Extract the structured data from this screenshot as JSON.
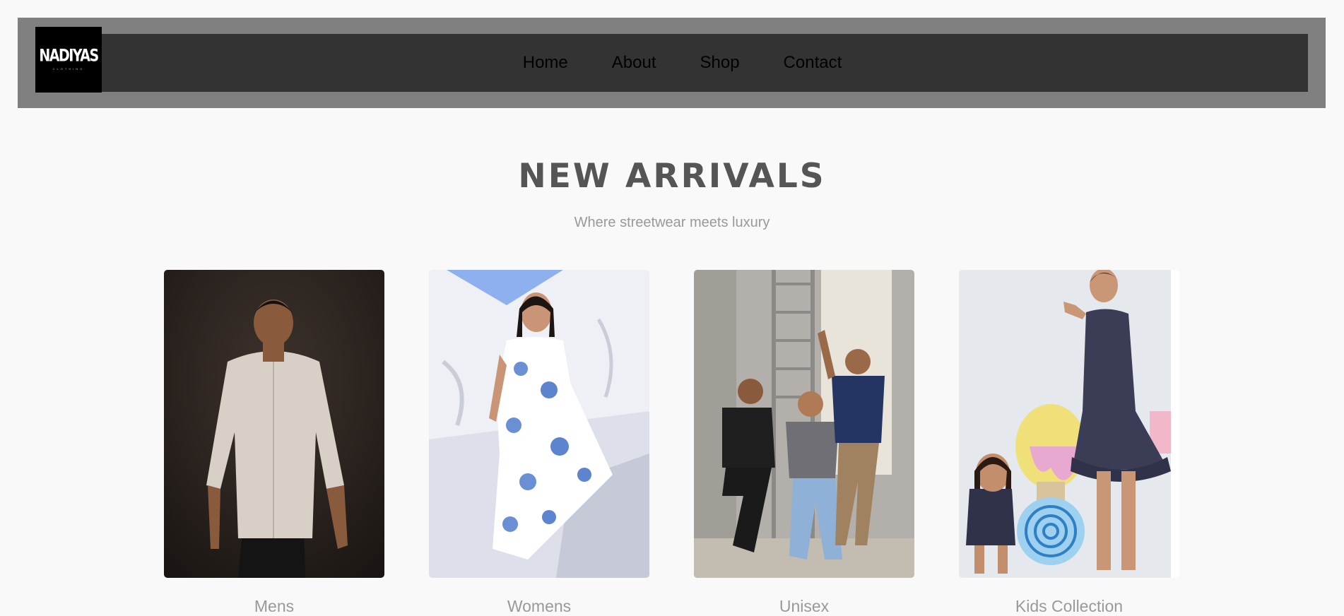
{
  "header": {
    "logo": {
      "text": "NADIYAS",
      "subtext": "CLOTHING"
    },
    "nav": [
      "Home",
      "About",
      "Shop",
      "Contact"
    ]
  },
  "hero": {
    "title": "NEW ARRIVALS",
    "subtitle": "Where streetwear meets luxury"
  },
  "products": [
    {
      "label": "Mens"
    },
    {
      "label": "Womens"
    },
    {
      "label": "Unisex"
    },
    {
      "label": "Kids Collection"
    }
  ],
  "colors": {
    "background": "#f9f9f9",
    "header_outer": "#808080",
    "header_inner": "#333333",
    "logo_bg": "#000000",
    "title": "#555555",
    "muted_text": "#999999"
  }
}
